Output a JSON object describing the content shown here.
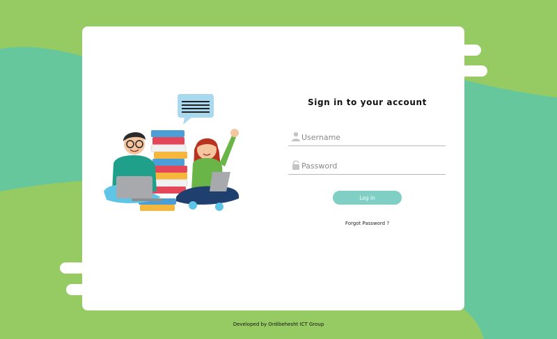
{
  "login": {
    "title": "Sign in to your account",
    "username_placeholder": "Username",
    "password_placeholder": "Password",
    "login_label": "Log in",
    "forgot_label": "Forgot Password ?"
  },
  "footer": {
    "text": "Developed by Ordibehesht ICT Group"
  },
  "icons": {
    "username": "user-icon",
    "password": "lock-icon"
  },
  "colors": {
    "background_green": "#96cb64",
    "background_teal": "#66c79c",
    "button": "#7fcfc5"
  }
}
